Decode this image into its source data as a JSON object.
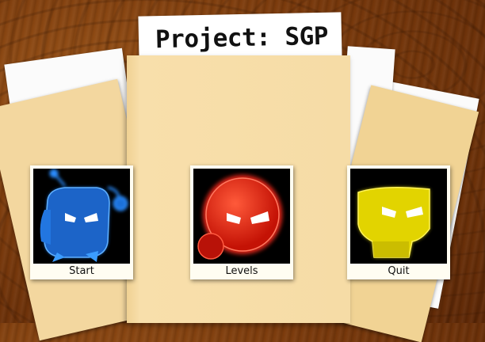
{
  "game": {
    "title": "Project: SGP"
  },
  "menu": {
    "items": [
      {
        "label": "Start",
        "color": "#2a8dff"
      },
      {
        "label": "Levels",
        "color": "#ff2a1a"
      },
      {
        "label": "Quit",
        "color": "#f5e600"
      }
    ]
  },
  "colors": {
    "wood": "#7a3a0c",
    "folder": "#f6dca6",
    "paper": "#fbfbfb"
  }
}
